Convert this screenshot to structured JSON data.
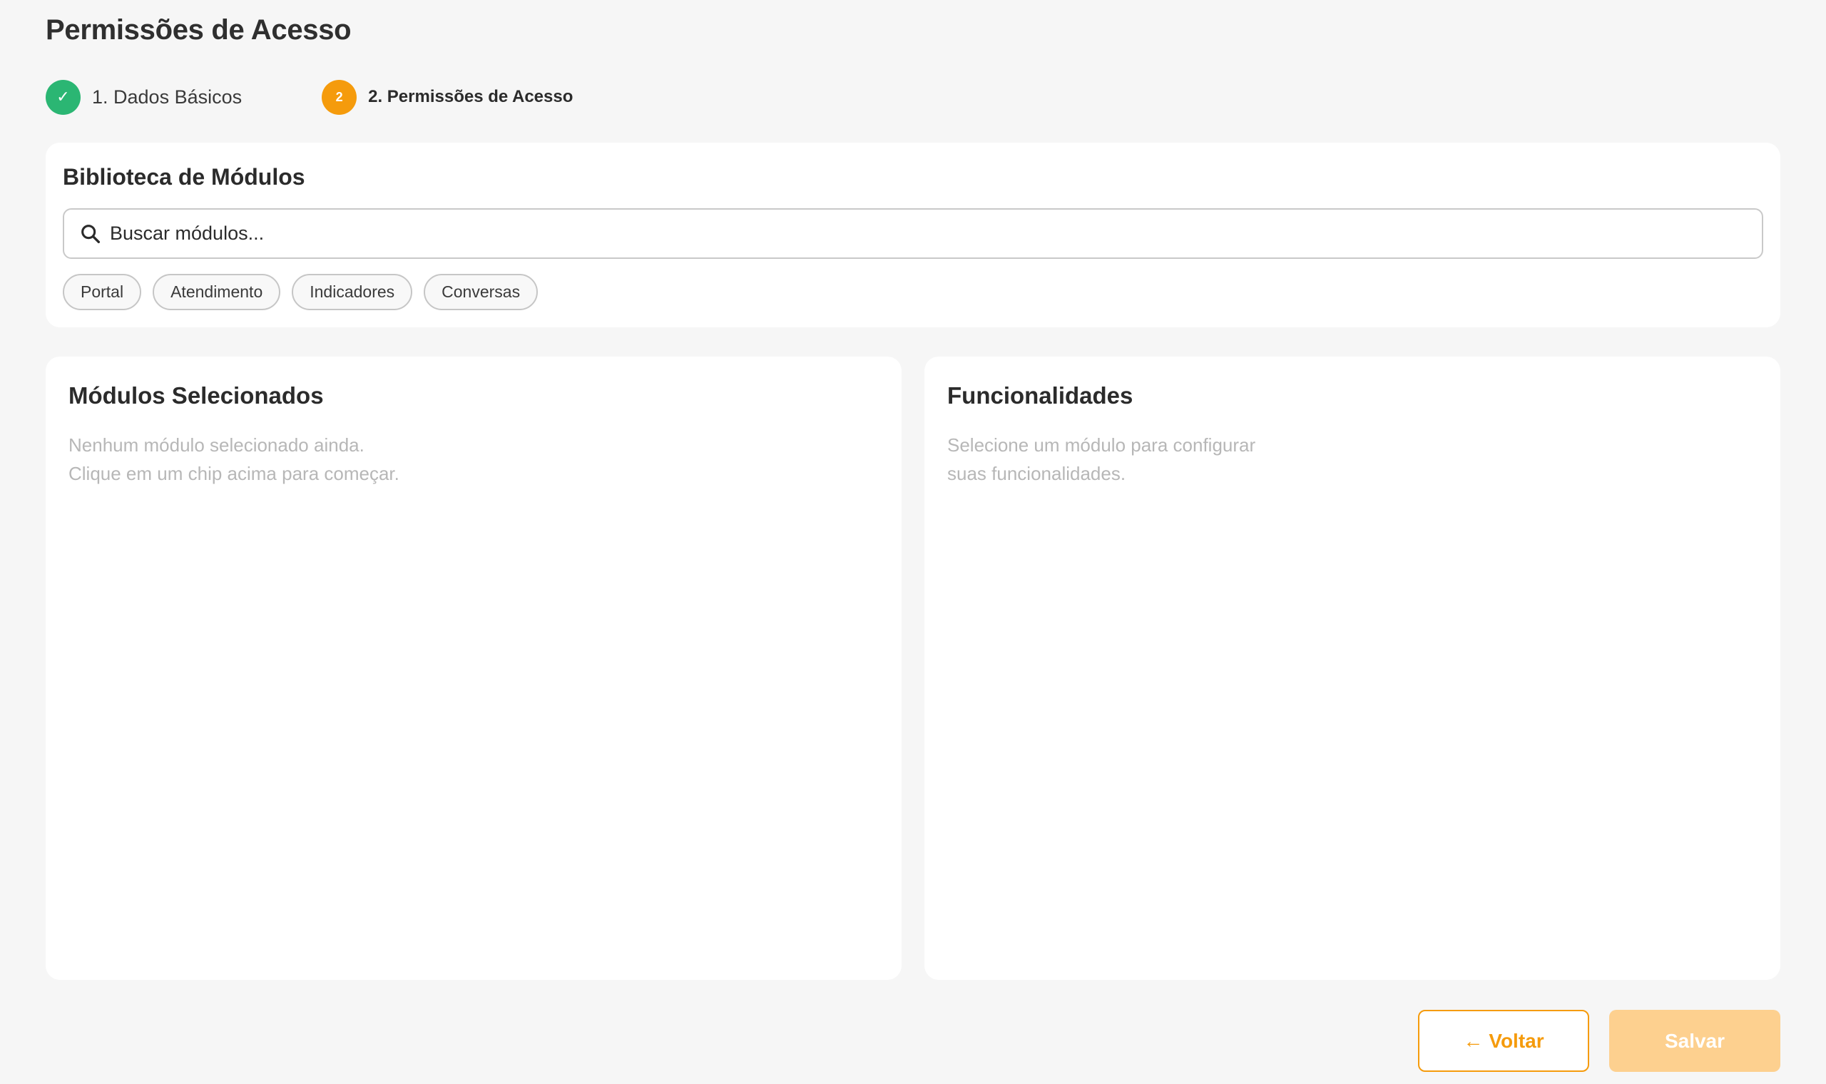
{
  "page": {
    "title": "Permissões de Acesso"
  },
  "stepper": {
    "steps": [
      {
        "number": "✓",
        "label": "1. Dados Básicos",
        "state": "completed"
      },
      {
        "number": "2",
        "label": "2. Permissões de Acesso",
        "state": "active"
      }
    ]
  },
  "library": {
    "title": "Biblioteca de Módulos",
    "search": {
      "placeholder": "Buscar módulos...",
      "value": ""
    },
    "chips": [
      "Portal",
      "Atendimento",
      "Indicadores",
      "Conversas"
    ]
  },
  "selected_modules": {
    "title": "Módulos Selecionados",
    "empty_line1": "Nenhum módulo selecionado ainda.",
    "empty_line2": "Clique em um chip acima para começar."
  },
  "features": {
    "title": "Funcionalidades",
    "empty_line1": "Selecione um módulo para configurar",
    "empty_line2": "suas funcionalidades."
  },
  "actions": {
    "back_arrow": "←",
    "back_label": "Voltar",
    "save_label": "Salvar"
  },
  "colors": {
    "accent": "#f59b0c",
    "success": "#2bb673",
    "save_disabled": "#fdd08f",
    "background": "#f6f6f6"
  },
  "icons": {
    "step_done": "check-icon",
    "search": "search-icon",
    "back": "arrow-left-icon"
  }
}
